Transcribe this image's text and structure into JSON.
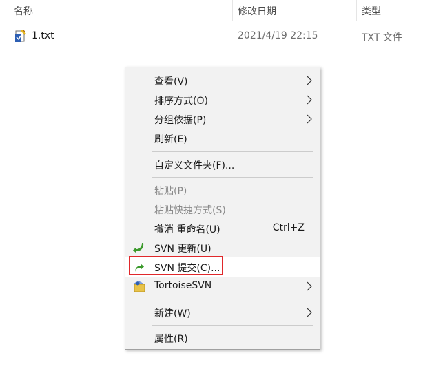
{
  "columns": {
    "name": "名称",
    "modified": "修改日期",
    "type": "类型"
  },
  "file": {
    "name": "1.txt",
    "modified": "2021/4/19 22:15",
    "type": "TXT 文件",
    "icon": "tortoisesvn-file-icon"
  },
  "menu": {
    "view": "查看(V)",
    "sort_by": "排序方式(O)",
    "group_by": "分组依据(P)",
    "refresh": "刷新(E)",
    "customize_folder": "自定义文件夹(F)...",
    "paste": "粘贴(P)",
    "paste_shortcut": "粘贴快捷方式(S)",
    "undo_rename": "撤消 重命名(U)",
    "undo_shortcut": "Ctrl+Z",
    "svn_update": "SVN 更新(U)",
    "svn_commit": "SVN 提交(C)...",
    "tortoisesvn": "TortoiseSVN",
    "new": "新建(W)",
    "properties": "属性(R)"
  },
  "colors": {
    "highlight_border": "#e0282b",
    "svn_green": "#3c9a2c"
  }
}
